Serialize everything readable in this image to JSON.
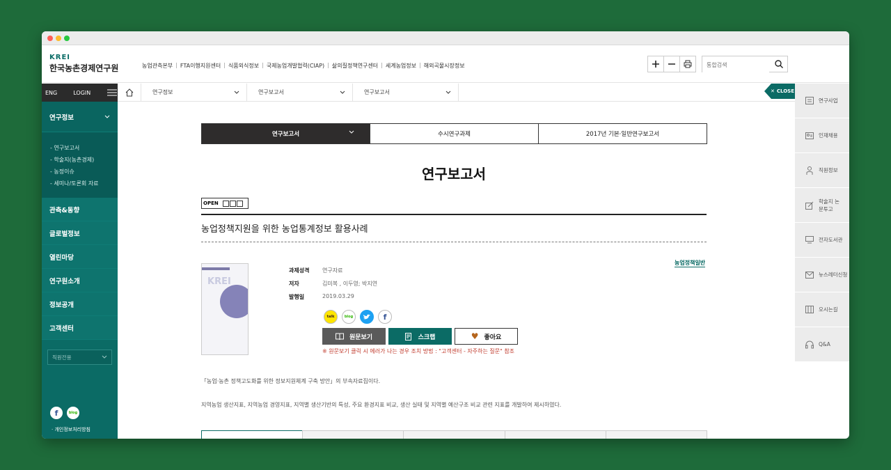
{
  "header": {
    "logo_en": "KREI",
    "logo_ko": "한국농촌경제연구원",
    "nav": [
      "농업관측본부",
      "FTA이행지원센터",
      "식품외식정보",
      "국제농업개발협력(CIAP)",
      "삶의질정책연구센터",
      "세계농업정보",
      "해외곡물시장정보"
    ],
    "search_placeholder": "통합검색"
  },
  "sidebar": {
    "eng": "ENG",
    "login": "LOGIN",
    "open_section": "연구정보",
    "sub_items": [
      "- 연구보고서",
      "- 학술지(농촌경제)",
      "- 농정이슈",
      "- 세미나/토론회 자료"
    ],
    "sections": [
      "관측&동향",
      "글로벌정보",
      "열린마당",
      "연구원소개",
      "정보공개",
      "고객센터"
    ],
    "staff_select": "직원전용",
    "footer": "· 개인정보처리방침"
  },
  "breadcrumb": [
    "연구정보",
    "연구보고서",
    "연구보고서"
  ],
  "close_label": "CLOSE",
  "quick_menu": [
    "연구사업",
    "인재채용",
    "직원정보",
    "학술지 논문투고",
    "전자도서관",
    "뉴스레터신청",
    "오시는길",
    "Q&A"
  ],
  "tabs": [
    "연구보고서",
    "수시연구과제",
    "2017년 기본·일반연구보고서"
  ],
  "page_title": "연구보고서",
  "badge": "OPEN",
  "doc": {
    "title": "농업정책지원을 위한 농업통계정보 활용사례",
    "category": "농업정책일반",
    "cover_text": "KREI",
    "meta": [
      {
        "key": "과제성격",
        "value": "연구자료"
      },
      {
        "key": "저자",
        "value": "김미복 , 이두영; 박지연"
      },
      {
        "key": "발행일",
        "value": "2019.03.29"
      }
    ]
  },
  "share_icons": [
    "kakao-talk-icon",
    "blog-icon",
    "twitter-icon",
    "facebook-icon"
  ],
  "actions": {
    "view": "원문보기",
    "scrap": "스크랩",
    "like": "좋아요"
  },
  "notice": "※ 원문보기 클릭 시 에러가 나는 경우 조치 방법 : \"고객센터 - 자주하는 질문\" 참조",
  "description": [
    "「농업·농촌 정책고도화를 위한 정보지원체계 구축 방안」의 부속자료집이다.",
    "지역농업 생산지표, 지역농업 경영지표, 지역별 생산기반의 특성, 주요 환경지표 비교, 생산 실태 및 지역별 예산구조 비교 관련 지표를 개발하여 제시하였다."
  ],
  "colors": {
    "brand": "#0b6b65",
    "notice": "#c0392b",
    "background": "#1e6b3a"
  }
}
